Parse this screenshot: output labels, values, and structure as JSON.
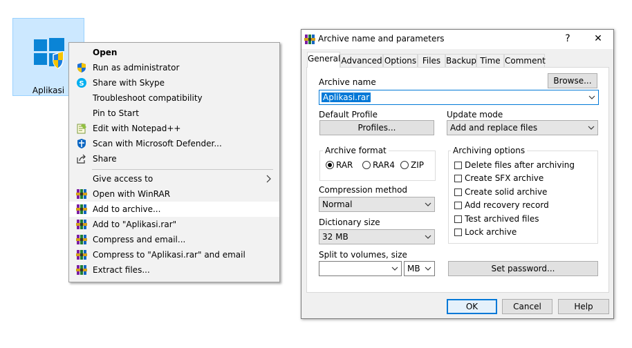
{
  "desktop_icon": {
    "label": "Aplikasi",
    "icon": "windows-shield-icon"
  },
  "context_menu": {
    "items": [
      {
        "label": "Open",
        "bold": true,
        "icon": ""
      },
      {
        "label": "Run as administrator",
        "icon": "uac-shield-icon"
      },
      {
        "label": "Share with Skype",
        "icon": "skype-icon"
      },
      {
        "label": "Troubleshoot compatibility",
        "icon": ""
      },
      {
        "label": "Pin to Start",
        "icon": ""
      },
      {
        "label": "Edit with Notepad++",
        "icon": "notepad-plus-plus-icon"
      },
      {
        "label": "Scan with Microsoft Defender...",
        "icon": "defender-icon"
      },
      {
        "label": "Share",
        "icon": "share-icon"
      },
      {
        "label": "Give access to",
        "icon": "",
        "submenu": "chevron-right-icon"
      },
      {
        "label": "Open with WinRAR",
        "icon": "winrar-icon"
      },
      {
        "label": "Add to archive...",
        "icon": "winrar-icon",
        "highlighted": true
      },
      {
        "label": "Add to \"Aplikasi.rar\"",
        "icon": "winrar-icon"
      },
      {
        "label": "Compress and email...",
        "icon": "winrar-icon"
      },
      {
        "label": "Compress to \"Aplikasi.rar\" and email",
        "icon": "winrar-icon"
      },
      {
        "label": "Extract files...",
        "icon": "winrar-icon"
      }
    ]
  },
  "dialog": {
    "title": "Archive name and parameters",
    "help_glyph": "?",
    "close_glyph": "✕",
    "tabs": [
      "General",
      "Advanced",
      "Options",
      "Files",
      "Backup",
      "Time",
      "Comment"
    ],
    "active_tab": "General",
    "browse_label": "Browse...",
    "archive_name_label": "Archive name",
    "archive_name_value": "Aplikasi.rar",
    "default_profile_label": "Default Profile",
    "profiles_label": "Profiles...",
    "update_mode_label": "Update mode",
    "update_mode_value": "Add and replace files",
    "archive_format_label": "Archive format",
    "formats": [
      "RAR",
      "RAR4",
      "ZIP"
    ],
    "selected_format": "RAR",
    "compression_method_label": "Compression method",
    "compression_method_value": "Normal",
    "dictionary_size_label": "Dictionary size",
    "dictionary_size_value": "32 MB",
    "split_label": "Split to volumes, size",
    "split_value": "",
    "split_unit": "MB",
    "archiving_options_label": "Archiving options",
    "options": [
      {
        "label": "Delete files after archiving",
        "checked": false
      },
      {
        "label": "Create SFX archive",
        "checked": false
      },
      {
        "label": "Create solid archive",
        "checked": false
      },
      {
        "label": "Add recovery record",
        "checked": false
      },
      {
        "label": "Test archived files",
        "checked": false
      },
      {
        "label": "Lock archive",
        "checked": false
      }
    ],
    "set_password_label": "Set password...",
    "ok_label": "OK",
    "cancel_label": "Cancel",
    "help_label": "Help"
  },
  "colors": {
    "selection": "#cce8ff",
    "input_selection": "#0078d7",
    "button_focus_border": "#0078d7"
  }
}
